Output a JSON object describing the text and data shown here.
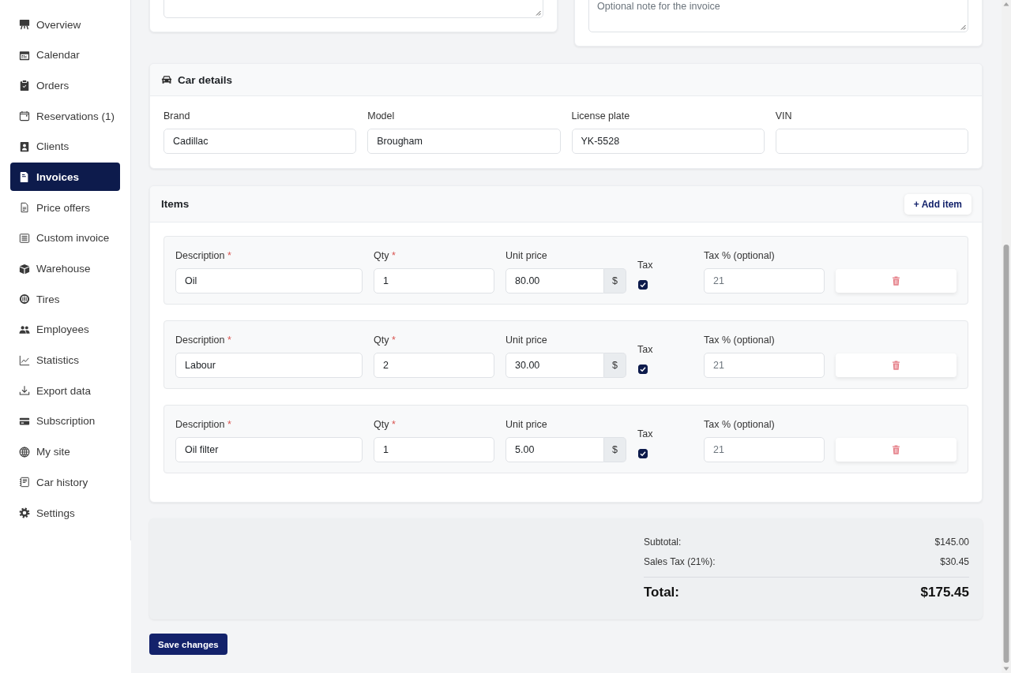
{
  "sidebar": {
    "items": [
      {
        "label": "Overview",
        "selected": false
      },
      {
        "label": "Calendar",
        "selected": false
      },
      {
        "label": "Orders",
        "selected": false
      },
      {
        "label": "Reservations (1)",
        "selected": false
      },
      {
        "label": "Clients",
        "selected": false
      },
      {
        "label": "Invoices",
        "selected": true
      },
      {
        "label": "Price offers",
        "selected": false
      },
      {
        "label": "Custom invoice",
        "selected": false
      },
      {
        "label": "Warehouse",
        "selected": false
      },
      {
        "label": "Tires",
        "selected": false
      },
      {
        "label": "Employees",
        "selected": false
      },
      {
        "label": "Statistics",
        "selected": false
      },
      {
        "label": "Export data",
        "selected": false
      },
      {
        "label": "Subscription",
        "selected": false
      },
      {
        "label": "My site",
        "selected": false
      },
      {
        "label": "Car history",
        "selected": false
      },
      {
        "label": "Settings",
        "selected": false
      }
    ]
  },
  "invoice_note": {
    "placeholder": "Optional note for the invoice"
  },
  "car_details": {
    "title": "Car details",
    "fields": [
      {
        "label": "Brand",
        "value": "Cadillac"
      },
      {
        "label": "Model",
        "value": "Brougham"
      },
      {
        "label": "License plate",
        "value": "YK-5528"
      },
      {
        "label": "VIN"
      }
    ]
  },
  "items": {
    "title": "Items",
    "add_button": "+ Add item",
    "rows": [
      {
        "description": {
          "label": "Description",
          "mark": "*",
          "value": "Oil"
        },
        "qty": {
          "label": "Qty",
          "mark": "*",
          "value": "1"
        },
        "unit_price": {
          "label": "Unit price",
          "value": "80.00",
          "addon": "$"
        },
        "tax": {
          "label": "Tax",
          "checked": true
        },
        "tax_percent": {
          "label": "Tax % (optional)",
          "placeholder": "21"
        }
      },
      {
        "description": {
          "label": "Description",
          "mark": "*",
          "value": "Labour"
        },
        "qty": {
          "label": "Qty",
          "mark": "*",
          "value": "2"
        },
        "unit_price": {
          "label": "Unit price",
          "value": "30.00",
          "addon": "$"
        },
        "tax": {
          "label": "Tax",
          "checked": true
        },
        "tax_percent": {
          "label": "Tax % (optional)",
          "placeholder": "21"
        }
      },
      {
        "description": {
          "label": "Description",
          "mark": "*",
          "value": "Oil filter"
        },
        "qty": {
          "label": "Qty",
          "mark": "*",
          "value": "1"
        },
        "unit_price": {
          "label": "Unit price",
          "value": "5.00",
          "addon": "$"
        },
        "tax": {
          "label": "Tax",
          "checked": true
        },
        "tax_percent": {
          "label": "Tax % (optional)",
          "placeholder": "21"
        }
      }
    ]
  },
  "totals": {
    "lines": [
      {
        "label": "Subtotal:",
        "amount": "$145.00"
      },
      {
        "label": "Sales Tax (21%):",
        "amount": "$30.45"
      }
    ],
    "total": {
      "label": "Total:",
      "amount": "$175.45"
    }
  },
  "save_button": "Save changes"
}
